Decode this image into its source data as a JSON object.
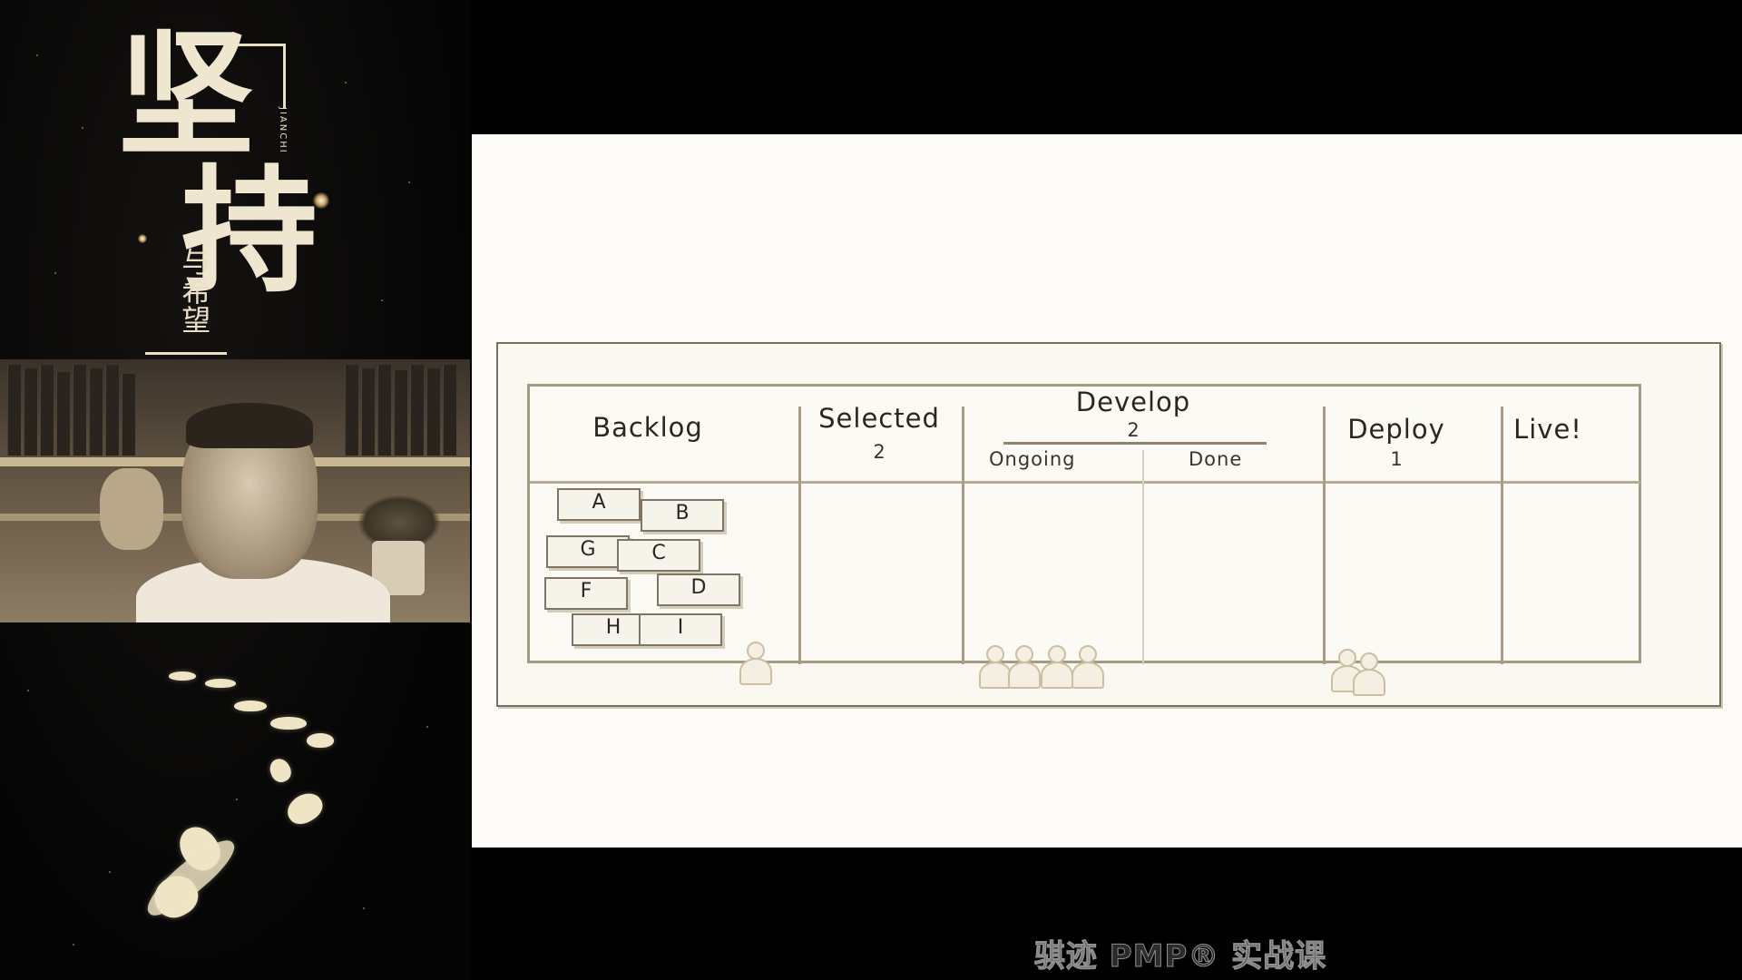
{
  "poster": {
    "main_chars": [
      "坚",
      "持"
    ],
    "sub_text": "与希望",
    "pinyin": "JIANCHI"
  },
  "kanban": {
    "columns": [
      {
        "name": "Backlog"
      },
      {
        "name": "Selected",
        "limit": "2"
      },
      {
        "name": "Develop",
        "limit": "2",
        "sub_columns": [
          "Ongoing",
          "Done"
        ]
      },
      {
        "name": "Deploy",
        "limit": "1"
      },
      {
        "name": "Live!"
      }
    ],
    "cards": [
      "A",
      "B",
      "G",
      "C",
      "F",
      "D",
      "H",
      "I"
    ]
  },
  "caption": "骐迹 PMP® 实战课"
}
